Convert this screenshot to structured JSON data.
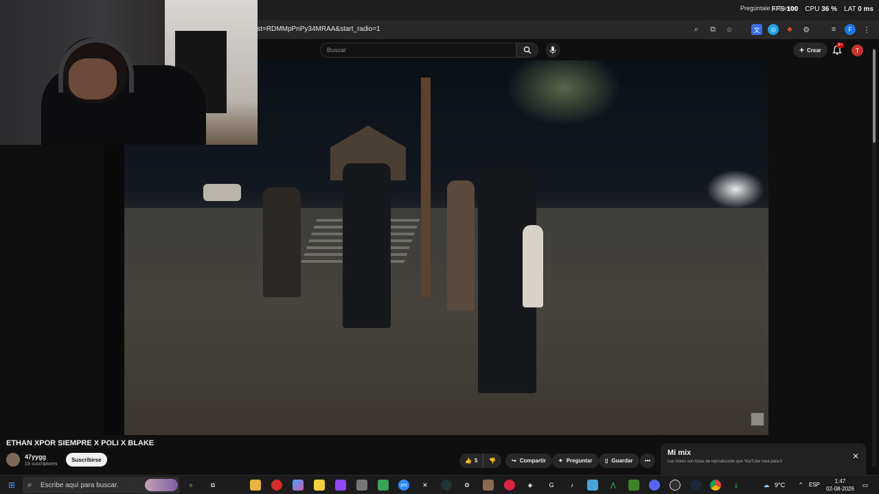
{
  "browser": {
    "url": "ist=RDMMpPnPy34MRAA&start_radio=1",
    "icons": [
      "zoom-icon",
      "install-icon",
      "star-icon",
      "translate-icon",
      "extension-icon",
      "extension-icon",
      "puzzle-icon",
      "tab-search-icon",
      "profile-icon",
      "menu-icon"
    ],
    "profile_letter": "F"
  },
  "overlay": {
    "note": "Pregúntale a Gemini",
    "fps_label": "FPS",
    "fps_value": "100",
    "cpu_label": "CPU",
    "cpu_value": "36 %",
    "lat_label": "LAT",
    "lat_value": "0 ms"
  },
  "youtube": {
    "search_placeholder": "Buscar",
    "create_label": "Crear",
    "notif_badge": "9+",
    "avatar_letter": "T"
  },
  "video": {
    "title": "ETHAN XPOR SIEMPRE X POLI X BLAKE",
    "channel_name": "47yygg",
    "channel_subs": "19 suscriptores",
    "subscribe_label": "Suscribirse",
    "like_count": "5",
    "share_label": "Compartir",
    "ask_label": "Preguntar",
    "save_label": "Guardar",
    "more_label": "•••"
  },
  "mix": {
    "title": "Mi mix",
    "description": "Los mixes son listas de reproducción que YouTube crea para ti"
  },
  "taskbar": {
    "search_placeholder": "Escribe aquí para buscar.",
    "weather": "9°C",
    "language": "ESP",
    "time": "1:47",
    "date": "02-08-2026"
  },
  "colors": {
    "youtube_bg": "#0f0f0f",
    "accent_red": "#cc0000",
    "taskbar_bg": "#1c1c1c"
  }
}
